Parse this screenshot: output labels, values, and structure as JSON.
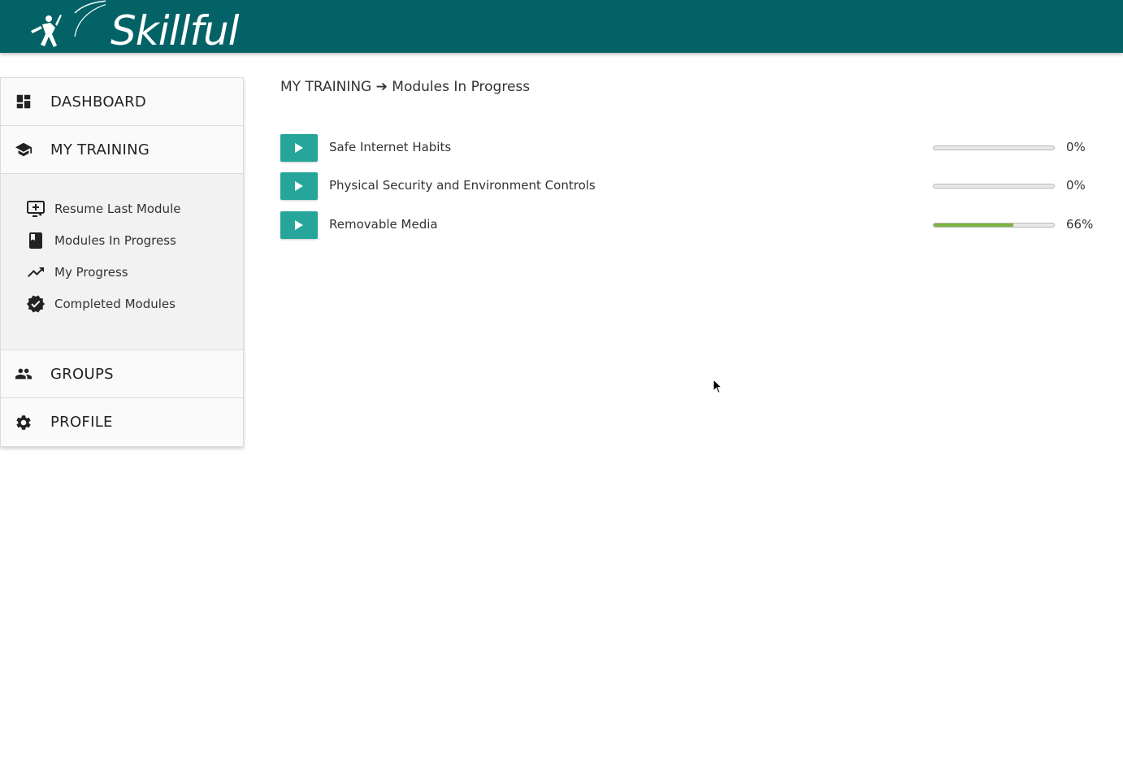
{
  "brand": {
    "name": "Skillful"
  },
  "nav": {
    "dashboard": "DASHBOARD",
    "my_training": "MY TRAINING",
    "groups": "GROUPS",
    "profile": "PROFILE",
    "training_items": [
      {
        "label": "Resume Last Module",
        "icon": "resume-icon"
      },
      {
        "label": "Modules In Progress",
        "icon": "book-icon"
      },
      {
        "label": "My Progress",
        "icon": "trending-up-icon"
      },
      {
        "label": "Completed Modules",
        "icon": "verified-badge-icon"
      }
    ]
  },
  "breadcrumb": {
    "section": "MY TRAINING",
    "separator": "➔",
    "page": "Modules In Progress"
  },
  "modules": [
    {
      "title": "Safe Internet Habits",
      "progress_label": "0%",
      "progress": 0
    },
    {
      "title": "Physical Security and Environment Controls",
      "progress_label": "0%",
      "progress": 0
    },
    {
      "title": "Removable Media",
      "progress_label": "66%",
      "progress": 66
    }
  ],
  "colors": {
    "header": "#036266",
    "play_button": "#26a69a",
    "progress_fill": "#7cb342"
  }
}
